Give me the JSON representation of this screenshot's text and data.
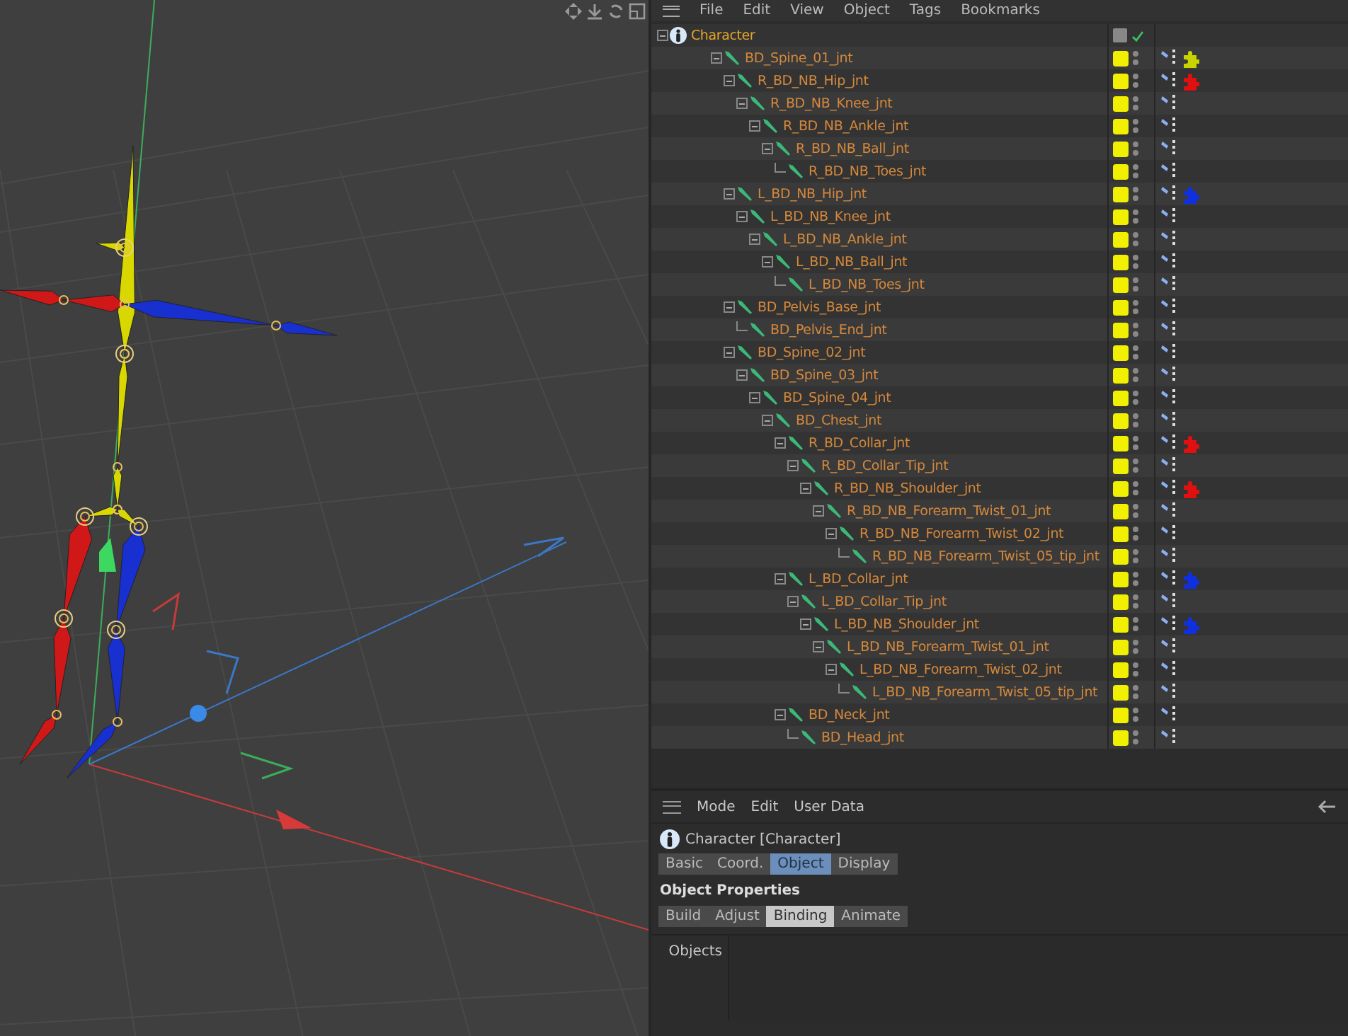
{
  "object_manager": {
    "menu": [
      "File",
      "Edit",
      "View",
      "Object",
      "Tags",
      "Bookmarks"
    ],
    "tree": [
      {
        "name": "Character",
        "kind": "character",
        "expanded": true,
        "children": [
          {
            "name": "BD_Spine_01_jnt",
            "kind": "joint",
            "expanded": true,
            "color": "#c8d400",
            "children": [
              {
                "name": "R_BD_NB_Hip_jnt",
                "kind": "joint",
                "expanded": true,
                "color": "#e01010",
                "children": [
                  {
                    "name": "R_BD_NB_Knee_jnt",
                    "kind": "joint",
                    "expanded": true,
                    "children": [
                      {
                        "name": "R_BD_NB_Ankle_jnt",
                        "kind": "joint",
                        "expanded": true,
                        "children": [
                          {
                            "name": "R_BD_NB_Ball_jnt",
                            "kind": "joint",
                            "expanded": true,
                            "children": [
                              {
                                "name": "R_BD_NB_Toes_jnt",
                                "kind": "joint"
                              }
                            ]
                          }
                        ]
                      }
                    ]
                  }
                ]
              },
              {
                "name": "L_BD_NB_Hip_jnt",
                "kind": "joint",
                "expanded": true,
                "color": "#1030e0",
                "children": [
                  {
                    "name": "L_BD_NB_Knee_jnt",
                    "kind": "joint",
                    "expanded": true,
                    "children": [
                      {
                        "name": "L_BD_NB_Ankle_jnt",
                        "kind": "joint",
                        "expanded": true,
                        "children": [
                          {
                            "name": "L_BD_NB_Ball_jnt",
                            "kind": "joint",
                            "expanded": true,
                            "children": [
                              {
                                "name": "L_BD_NB_Toes_jnt",
                                "kind": "joint"
                              }
                            ]
                          }
                        ]
                      }
                    ]
                  }
                ]
              },
              {
                "name": "BD_Pelvis_Base_jnt",
                "kind": "joint",
                "expanded": true,
                "children": [
                  {
                    "name": "BD_Pelvis_End_jnt",
                    "kind": "joint"
                  }
                ]
              },
              {
                "name": "BD_Spine_02_jnt",
                "kind": "joint",
                "expanded": true,
                "children": [
                  {
                    "name": "BD_Spine_03_jnt",
                    "kind": "joint",
                    "expanded": true,
                    "children": [
                      {
                        "name": "BD_Spine_04_jnt",
                        "kind": "joint",
                        "expanded": true,
                        "children": [
                          {
                            "name": "BD_Chest_jnt",
                            "kind": "joint",
                            "expanded": true,
                            "children": [
                              {
                                "name": "R_BD_Collar_jnt",
                                "kind": "joint",
                                "expanded": true,
                                "color": "#e01010",
                                "children": [
                                  {
                                    "name": "R_BD_Collar_Tip_jnt",
                                    "kind": "joint",
                                    "expanded": true,
                                    "children": [
                                      {
                                        "name": "R_BD_NB_Shoulder_jnt",
                                        "kind": "joint",
                                        "expanded": true,
                                        "color": "#e01010",
                                        "children": [
                                          {
                                            "name": "R_BD_NB_Forearm_Twist_01_jnt",
                                            "kind": "joint",
                                            "expanded": true,
                                            "children": [
                                              {
                                                "name": "R_BD_NB_Forearm_Twist_02_jnt",
                                                "kind": "joint",
                                                "expanded": true,
                                                "children": [
                                                  {
                                                    "name": "R_BD_NB_Forearm_Twist_05_tip_jnt",
                                                    "kind": "joint"
                                                  }
                                                ]
                                              }
                                            ]
                                          }
                                        ]
                                      }
                                    ]
                                  }
                                ]
                              },
                              {
                                "name": "L_BD_Collar_jnt",
                                "kind": "joint",
                                "expanded": true,
                                "color": "#1030e0",
                                "children": [
                                  {
                                    "name": "L_BD_Collar_Tip_jnt",
                                    "kind": "joint",
                                    "expanded": true,
                                    "children": [
                                      {
                                        "name": "L_BD_NB_Shoulder_jnt",
                                        "kind": "joint",
                                        "expanded": true,
                                        "color": "#1030e0",
                                        "children": [
                                          {
                                            "name": "L_BD_NB_Forearm_Twist_01_jnt",
                                            "kind": "joint",
                                            "expanded": true,
                                            "children": [
                                              {
                                                "name": "L_BD_NB_Forearm_Twist_02_jnt",
                                                "kind": "joint",
                                                "expanded": true,
                                                "children": [
                                                  {
                                                    "name": "L_BD_NB_Forearm_Twist_05_tip_jnt",
                                                    "kind": "joint"
                                                  }
                                                ]
                                              }
                                            ]
                                          }
                                        ]
                                      }
                                    ]
                                  }
                                ]
                              },
                              {
                                "name": "BD_Neck_jnt",
                                "kind": "joint",
                                "expanded": true,
                                "children": [
                                  {
                                    "name": "BD_Head_jnt",
                                    "kind": "joint"
                                  }
                                ]
                              }
                            ]
                          }
                        ]
                      }
                    ]
                  }
                ]
              }
            ]
          }
        ]
      }
    ]
  },
  "attribute_manager": {
    "menu": [
      "Mode",
      "Edit",
      "User Data"
    ],
    "object_title": "Character [Character]",
    "tabs": [
      {
        "label": "Basic",
        "selected": false
      },
      {
        "label": "Coord.",
        "selected": false
      },
      {
        "label": "Object",
        "selected": true
      },
      {
        "label": "Display",
        "selected": false
      }
    ],
    "section_title": "Object Properties",
    "subtabs": [
      {
        "label": "Build",
        "selected": false
      },
      {
        "label": "Adjust",
        "selected": false
      },
      {
        "label": "Binding",
        "selected": true
      },
      {
        "label": "Animate",
        "selected": false
      }
    ],
    "field_label": "Objects"
  }
}
